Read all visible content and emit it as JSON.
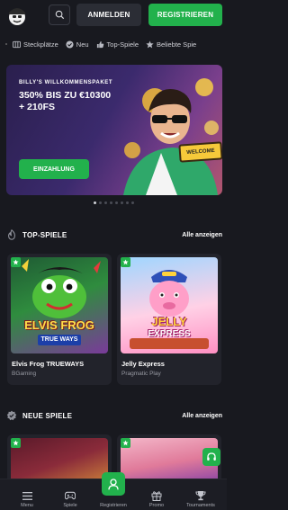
{
  "header": {
    "login_label": "ANMELDEN",
    "register_label": "REGISTRIEREN"
  },
  "nav": {
    "items": [
      {
        "label": "Steckplätze",
        "icon": "slots-icon"
      },
      {
        "label": "Neu",
        "icon": "check-badge-icon"
      },
      {
        "label": "Top-Spiele",
        "icon": "thumbs-up-icon"
      },
      {
        "label": "Beliebte Spie",
        "icon": "star-icon"
      }
    ]
  },
  "banner": {
    "small_text": "BILLY'S WILLKOMMENSPAKET",
    "headline_line1": "350% BIS ZU €10300",
    "headline_line2": "+ 210FS",
    "cta_label": "EINZAHLUNG",
    "sign_text": "WELCOME",
    "slides_total": 8,
    "active_slide": 1
  },
  "top_games": {
    "title": "TOP-SPIELE",
    "see_all": "Alle anzeigen",
    "games": [
      {
        "title": "Elvis Frog TRUEWAYS",
        "provider": "BGaming",
        "art_line1": "ELVIS FROG",
        "art_line2": "TRUE WAYS"
      },
      {
        "title": "Jelly Express",
        "provider": "Pragmatic Play",
        "art_line1": "JELLY",
        "art_line2": "EXPRESS"
      }
    ]
  },
  "new_games": {
    "title": "NEUE SPIELE",
    "see_all": "Alle anzeigen"
  },
  "bottom_nav": {
    "items": [
      {
        "label": "Menu",
        "icon": "menu-icon"
      },
      {
        "label": "Spiele",
        "icon": "gamepad-icon"
      },
      {
        "label": "Registrieren",
        "icon": "user-icon"
      },
      {
        "label": "Promo",
        "icon": "gift-icon"
      },
      {
        "label": "Tournaments",
        "icon": "trophy-icon"
      }
    ]
  },
  "colors": {
    "background": "#18191f",
    "accent": "#22b14c",
    "card": "#22232b"
  }
}
